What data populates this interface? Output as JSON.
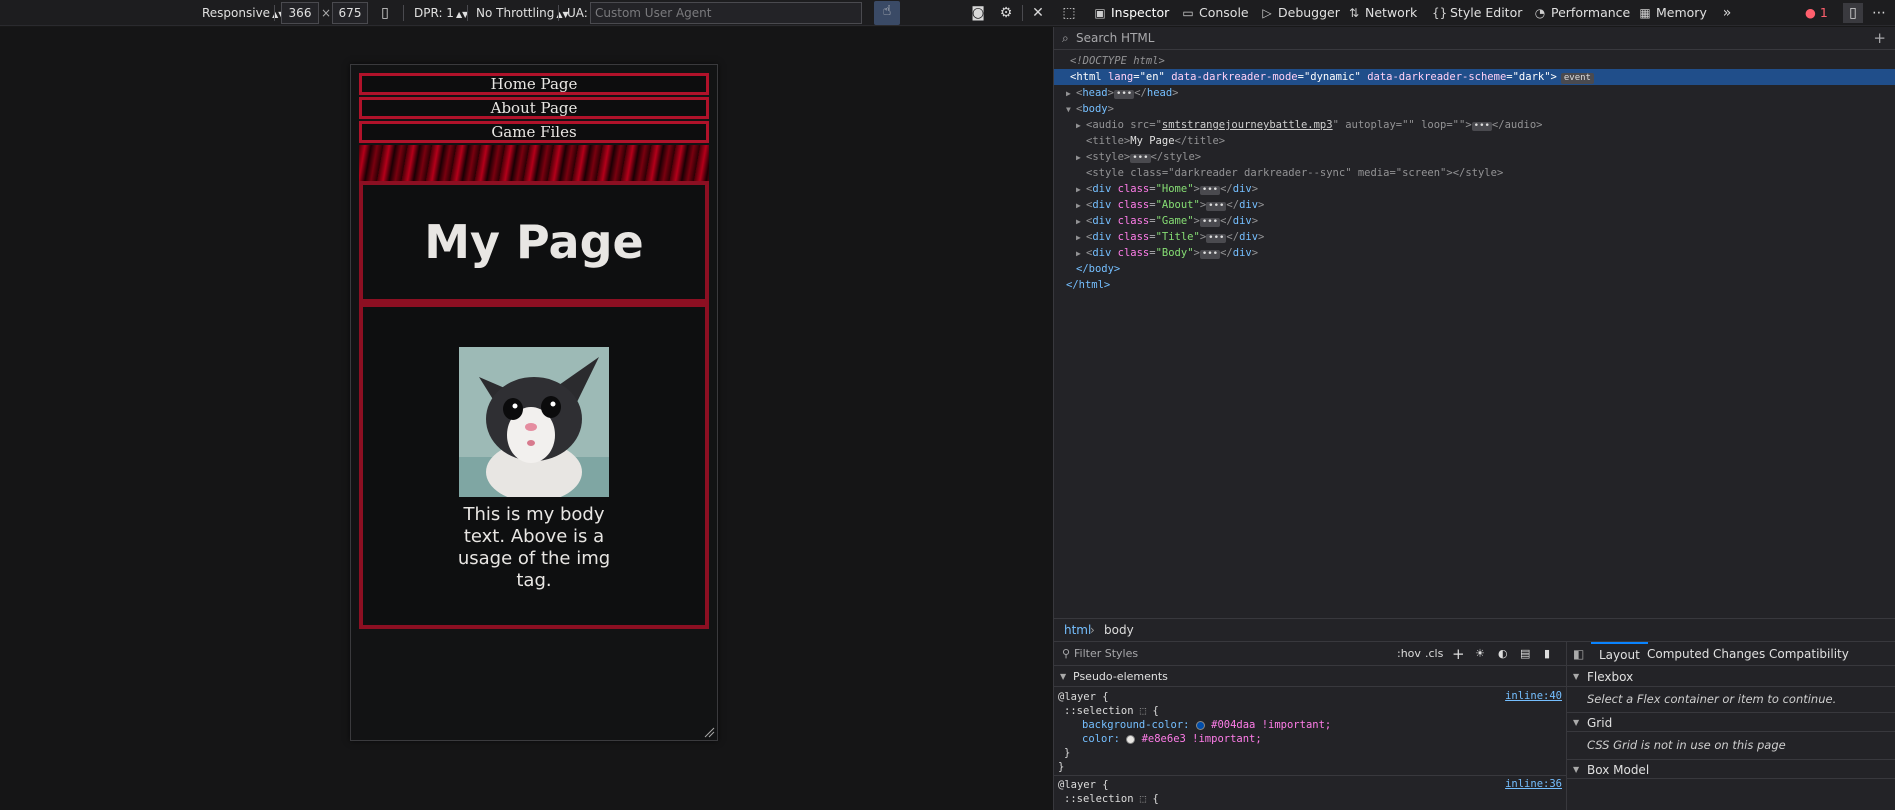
{
  "toolbar": {
    "device": "Responsive",
    "width": "366",
    "times": "×",
    "height": "675",
    "dpr": "DPR: 1",
    "throttling": "No Throttling",
    "ua_label": "UA:",
    "ua_placeholder": "Custom User Agent"
  },
  "devtools_tabs": [
    {
      "label": "Inspector",
      "icon": "inspector-icon"
    },
    {
      "label": "Console",
      "icon": "console-icon"
    },
    {
      "label": "Debugger",
      "icon": "debugger-icon"
    },
    {
      "label": "Network",
      "icon": "network-icon"
    },
    {
      "label": "Style Editor",
      "icon": "style-editor-icon"
    },
    {
      "label": "Performance",
      "icon": "performance-icon"
    },
    {
      "label": "Memory",
      "icon": "memory-icon"
    }
  ],
  "error_count": "1",
  "page": {
    "nav": [
      "Home Page",
      "About Page",
      "Game Files"
    ],
    "title": "My Page",
    "body_text": "This is my body text. Above is a usage of the img tag."
  },
  "search_html": "Search HTML",
  "markup": {
    "doctype": "<!DOCTYPE html>",
    "html_open": "html",
    "lang_attr": "lang",
    "lang_val": "\"en\"",
    "dr_mode_attr": "data-darkreader-mode",
    "dr_mode_val": "\"dynamic\"",
    "dr_scheme_attr": "data-darkreader-scheme",
    "dr_scheme_val": "\"dark\"",
    "event_badge": "event",
    "head": "head",
    "body": "body",
    "audio_src": "smtstrangejourneybattle.mp3",
    "title_text": "My Page",
    "style_class": "darkreader darkreader--sync",
    "style_media": "screen",
    "divs": [
      "Home",
      "About",
      "Game",
      "Title",
      "Body"
    ],
    "html_close": "</html>",
    "body_close": "</body>"
  },
  "breadcrumb": [
    "html",
    "body"
  ],
  "rules": {
    "filter_placeholder": "Filter Styles",
    "hov": ":hov",
    "cls": ".cls",
    "pseudo_header": "Pseudo-elements",
    "layer": "@layer {",
    "selection": "::selection",
    "bg_prop": "background-color:",
    "bg_val": "#004daa !important;",
    "color_prop": "color:",
    "color_val": "#e8e6e3 !important;",
    "link1": "inline:40",
    "link2": "inline:36",
    "bg_swatch": "#004daa",
    "color_swatch": "#e8e6e3"
  },
  "side": {
    "tabs": [
      "Layout",
      "Computed",
      "Changes",
      "Compatibility"
    ],
    "flexbox": "Flexbox",
    "flexbox_note": "Select a Flex container or item to continue.",
    "grid": "Grid",
    "grid_note": "CSS Grid is not in use on this page",
    "box_model": "Box Model"
  },
  "colors": {
    "accent": "#b0122a",
    "selection": "#204e8a",
    "tab_active": "#0a84ff"
  }
}
